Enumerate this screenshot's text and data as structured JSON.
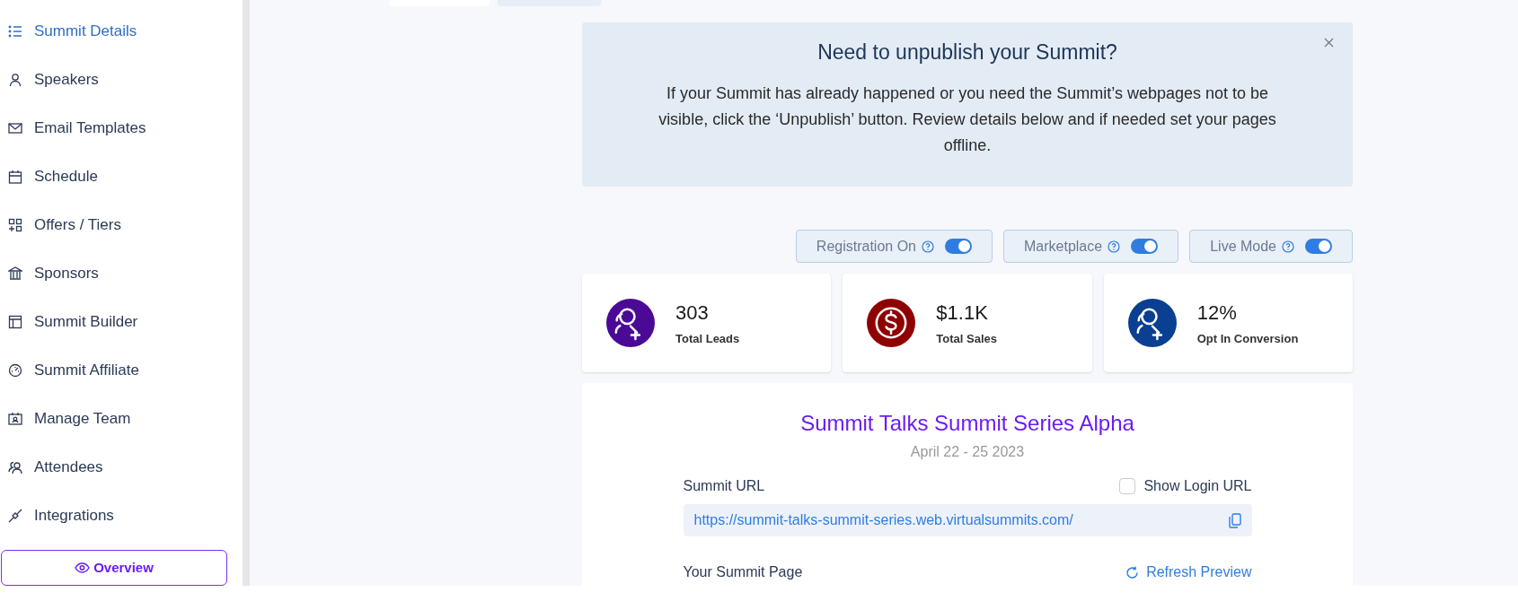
{
  "sidebar": {
    "items": [
      {
        "label": "Summit Details",
        "kind": "list",
        "selected": true
      },
      {
        "label": "Speakers",
        "kind": "user",
        "selected": false
      },
      {
        "label": "Email Templates",
        "kind": "mail",
        "selected": false
      },
      {
        "label": "Schedule",
        "kind": "calendar",
        "selected": false
      },
      {
        "label": "Offers / Tiers",
        "kind": "grid",
        "selected": false
      },
      {
        "label": "Sponsors",
        "kind": "bank",
        "selected": false
      },
      {
        "label": "Summit Builder",
        "kind": "layout",
        "selected": false
      },
      {
        "label": "Summit Affiliate",
        "kind": "gauge",
        "selected": false
      },
      {
        "label": "Manage Team",
        "kind": "badge",
        "selected": false
      },
      {
        "label": "Attendees",
        "kind": "users",
        "selected": false
      },
      {
        "label": "Integrations",
        "kind": "plug",
        "selected": false
      }
    ],
    "overview_button": "Overview"
  },
  "top_tabs": [
    {
      "selected": true
    },
    {
      "selected": false
    }
  ],
  "banner": {
    "title": "Need to unpublish your Summit?",
    "text": "If your Summit has already happened or you need the Summit’s webpages not to be visible, click the ‘Unpublish’ button. Review details below and if needed set your pages offline."
  },
  "toggles": [
    {
      "label": "Registration On",
      "on": true
    },
    {
      "label": "Marketplace",
      "on": true
    },
    {
      "label": "Live Mode",
      "on": true
    }
  ],
  "stats": [
    {
      "value": "303",
      "label": "Total Leads",
      "kind": "user-plus",
      "color": "#4b0a96"
    },
    {
      "value": "$1.1K",
      "label": "Total Sales",
      "kind": "dollar",
      "color": "#8f0000"
    },
    {
      "value": "12%",
      "label": "Opt In Conversion",
      "kind": "user-plus",
      "color": "#0a3f91"
    }
  ],
  "summit": {
    "title": "Summit Talks Summit Series Alpha",
    "dates": "April 22 - 25 2023",
    "url_label": "Summit URL",
    "show_login": {
      "label": "Show Login URL",
      "checked": false
    },
    "url": "https://summit-talks-summit-series.web.virtualsummits.com/",
    "page_label": "Your Summit Page",
    "refresh": "Refresh Preview"
  }
}
